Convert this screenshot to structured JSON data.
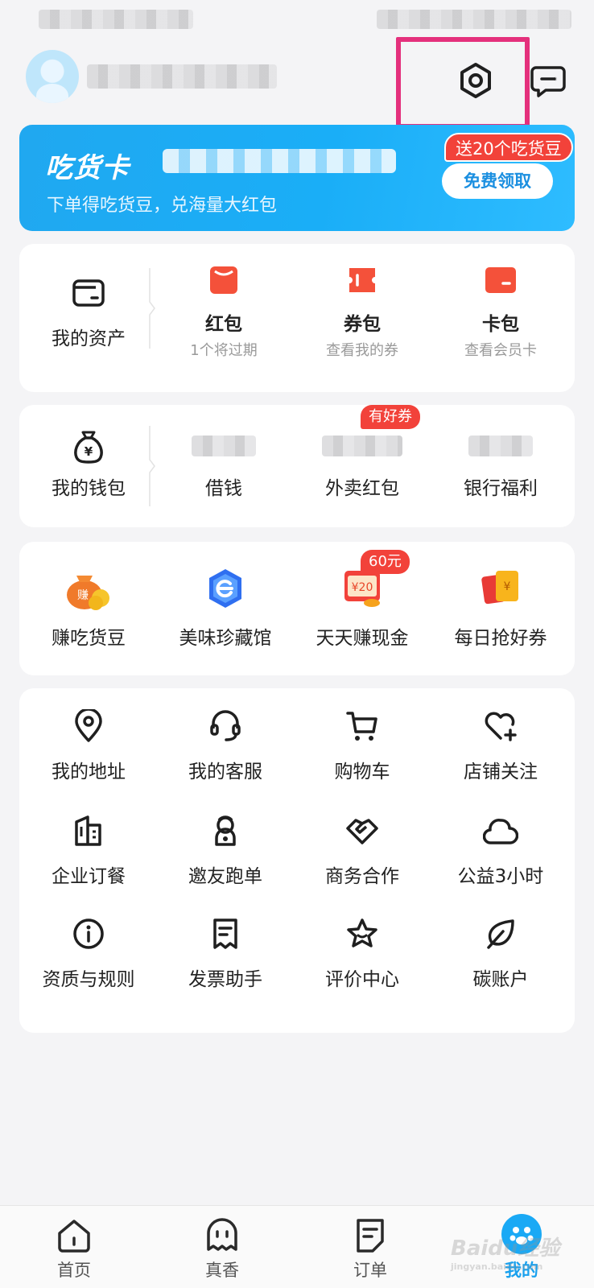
{
  "profile": {
    "settings_icon": "settings-icon",
    "message_icon": "message-icon"
  },
  "banner": {
    "title": "吃货卡",
    "subtitle": "下单得吃货豆，兑海量大红包",
    "badge": "送20个吃货豆",
    "button": "免费领取"
  },
  "assets": {
    "main_label": "我的资产",
    "items": [
      {
        "label": "红包",
        "sub": "1个将过期"
      },
      {
        "label": "券包",
        "sub": "查看我的券"
      },
      {
        "label": "卡包",
        "sub": "查看会员卡"
      }
    ]
  },
  "wallet": {
    "main_label": "我的钱包",
    "tag": "有好券",
    "items": [
      {
        "label": "借钱"
      },
      {
        "label": "外卖红包"
      },
      {
        "label": "银行福利"
      }
    ]
  },
  "promos": {
    "tag": "60元",
    "coin_text": "赚",
    "coupon_text": "¥20",
    "items": [
      {
        "label": "赚吃货豆"
      },
      {
        "label": "美味珍藏馆"
      },
      {
        "label": "天天赚现金"
      },
      {
        "label": "每日抢好券"
      }
    ]
  },
  "services": [
    {
      "label": "我的地址",
      "icon": "location-pin-icon"
    },
    {
      "label": "我的客服",
      "icon": "headset-icon"
    },
    {
      "label": "购物车",
      "icon": "cart-icon"
    },
    {
      "label": "店铺关注",
      "icon": "heart-plus-icon"
    },
    {
      "label": "企业订餐",
      "icon": "building-icon"
    },
    {
      "label": "邀友跑单",
      "icon": "rider-icon"
    },
    {
      "label": "商务合作",
      "icon": "handshake-icon"
    },
    {
      "label": "公益3小时",
      "icon": "cloud-icon"
    },
    {
      "label": "资质与规则",
      "icon": "info-icon"
    },
    {
      "label": "发票助手",
      "icon": "receipt-icon"
    },
    {
      "label": "评价中心",
      "icon": "star-icon"
    },
    {
      "label": "碳账户",
      "icon": "leaf-icon"
    }
  ],
  "nav": [
    {
      "label": "首页",
      "icon": "home-icon"
    },
    {
      "label": "真香",
      "icon": "ghost-icon"
    },
    {
      "label": "订单",
      "icon": "order-icon"
    },
    {
      "label": "我的",
      "icon": "profile-icon"
    }
  ],
  "watermark": {
    "text": "Baidu经验",
    "sub": "jingyan.baidu.com"
  },
  "colors": {
    "accent": "#1aa1ee",
    "brand_red": "#f2423a",
    "highlight": "#e4307c"
  }
}
